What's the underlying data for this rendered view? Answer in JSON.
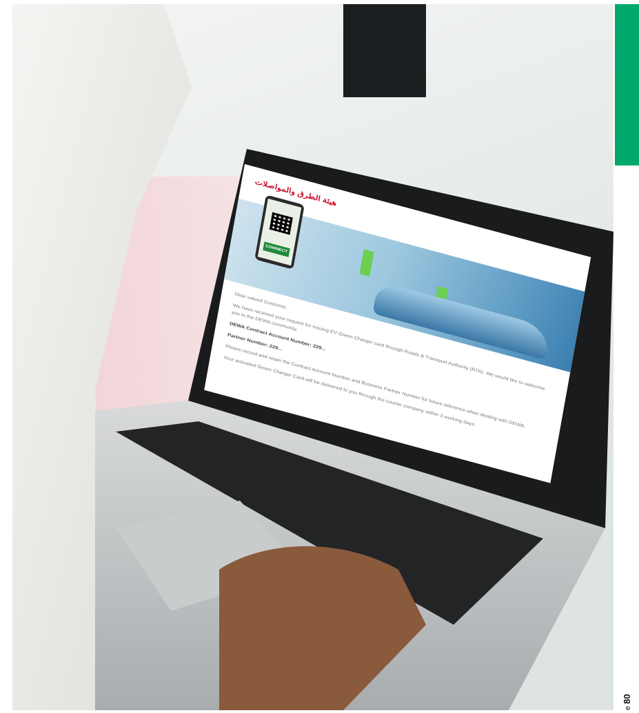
{
  "laptop_screen": {
    "rta_logo_text": "هيئة الطرق والمواصلات",
    "connect_button": "CONNECT",
    "greeting": "Dear valued Customer,",
    "para1": "We have received your request for Issuing EV Green Charger card through Roads & Transport Authority (RTA). We would like to welcome you in the DEWA community.",
    "account_line": "DEWA Contract Account Number: 229...",
    "partner_line": "Partner Number: 229...",
    "para2": "Please record and retain the Contract Account Number and Business Partner Number for future reference when dealing with DEWA.",
    "para3": "Your activated Green Charger Card will be delivered to you through the courier company within 3 working days."
  },
  "page_label": {
    "prefix": "e",
    "number": "80"
  },
  "colors": {
    "green_tab": "#00a86b",
    "charger_green": "#6ccf52",
    "rta_red": "#c8102e"
  }
}
